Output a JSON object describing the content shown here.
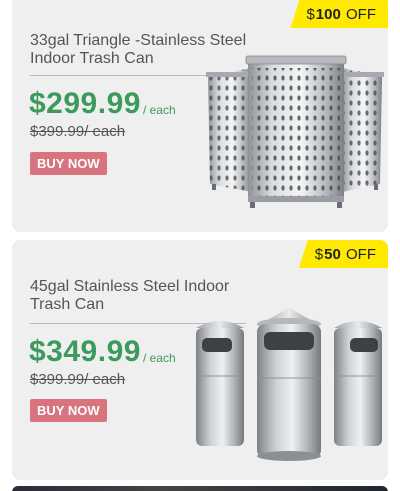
{
  "products": [
    {
      "discount": {
        "currency": "$",
        "amount": "100",
        "suffix": " OFF"
      },
      "title": "33gal Triangle -Stainless Steel Indoor Trash Can",
      "price": "$299.99",
      "per": "/ each",
      "old_price": "$399.99/ each",
      "buy_label": "BUY NOW"
    },
    {
      "discount": {
        "currency": "$",
        "amount": "50",
        "suffix": " OFF"
      },
      "title": "45gal Stainless Steel Indoor Trash Can",
      "price": "$349.99",
      "per": "/ each",
      "old_price": "$399.99/ each",
      "buy_label": "BUY NOW"
    }
  ],
  "colors": {
    "badge": "#ffe900",
    "price": "#3c9a5c",
    "buy_button": "#d9747e",
    "card": "#f0efef"
  }
}
